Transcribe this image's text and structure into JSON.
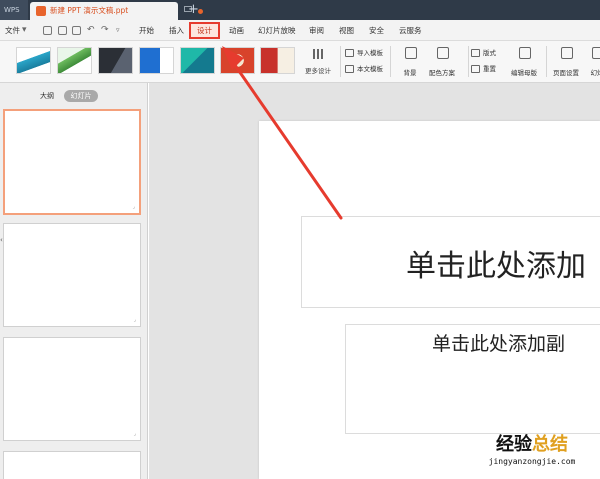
{
  "titlebar": {
    "app_tab": "WPS",
    "document_title": "新建 PPT 演示文稿.ppt"
  },
  "menu": {
    "file": "文件",
    "items": [
      "开始",
      "插入",
      "设计",
      "动画",
      "幻灯片放映",
      "审阅",
      "视图",
      "安全",
      "云服务"
    ],
    "active": "设计"
  },
  "ribbon": {
    "more_design": "更多设计",
    "import_template": "导入模板",
    "this_template": "本文模板",
    "background": "背景",
    "color_scheme": "配色方案",
    "layout": "版式",
    "reset": "重置",
    "edit_master": "编辑母版",
    "page_setup": "页面设置",
    "slide_size": "幻灯"
  },
  "left_panel": {
    "tab_outline": "大纲",
    "tab_slides": "幻灯片"
  },
  "slide": {
    "title_placeholder": "单击此处添加",
    "subtitle_placeholder": "单击此处添加副"
  },
  "watermark": {
    "main_part1": "经验",
    "main_part2": "总结",
    "url": "jingyanzongjie.com"
  },
  "colors": {
    "accent": "#e63b2e",
    "titlebar": "#2f3a48"
  }
}
